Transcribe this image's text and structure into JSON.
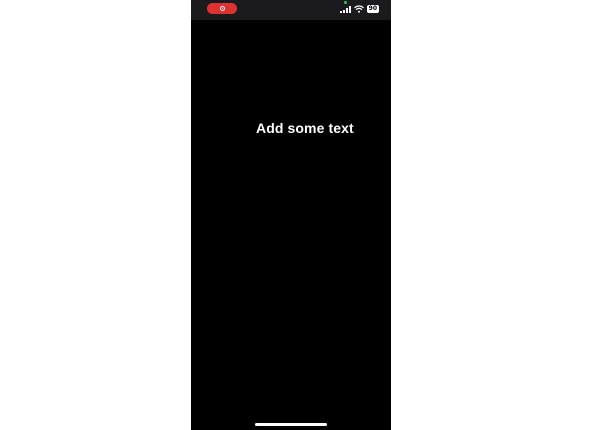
{
  "status_bar": {
    "recording_icon": "screen-recording-icon",
    "signal_icon": "cellular-signal-icon",
    "wifi_icon": "wifi-icon",
    "battery_level": "90"
  },
  "editor": {
    "text_placeholder": "Add some text"
  },
  "colors": {
    "background": "#000000",
    "recording_pill": "#e03131",
    "text": "#ffffff"
  }
}
